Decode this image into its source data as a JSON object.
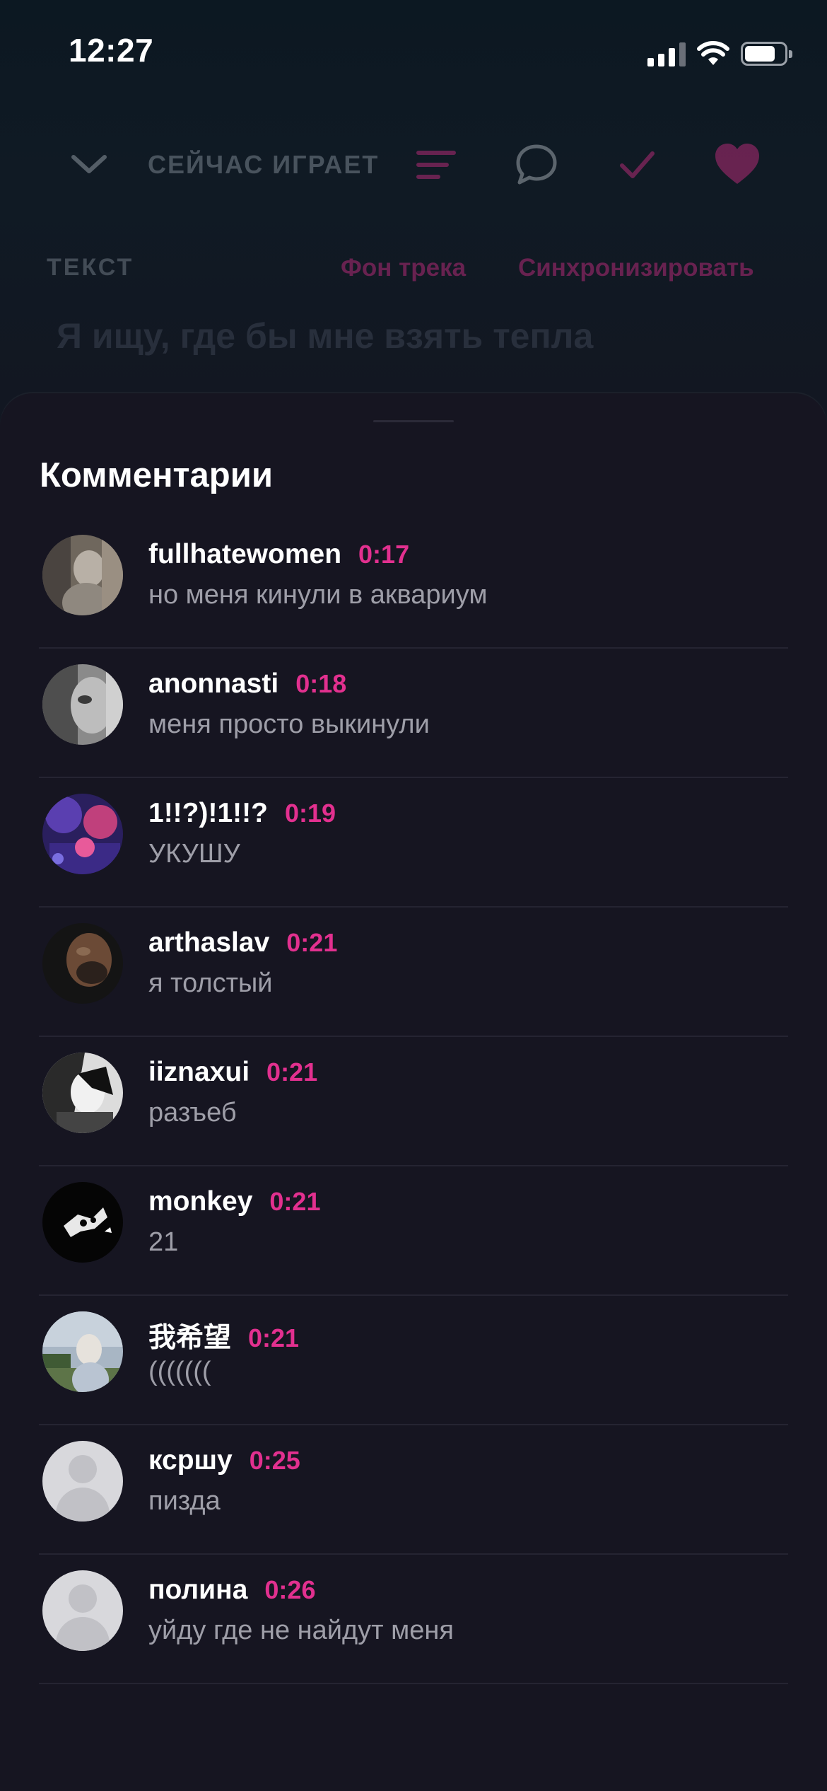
{
  "status_bar": {
    "time": "12:27"
  },
  "player": {
    "now_playing_label": "СЕЙЧАС ИГРАЕТ",
    "lyrics_label": "ТЕКСТ",
    "track_background_link": "Фон трека",
    "sync_link": "Синхронизировать",
    "lyrics_first_line": "Я ищу, где бы мне взять тепла",
    "accent_color": "#e2308f"
  },
  "comments": {
    "title": "Комментарии",
    "items": [
      {
        "user": "fullhatewomen",
        "time": "0:17",
        "text": "но меня кинули в аквариум",
        "avatar": "photo-avatar"
      },
      {
        "user": "anonnasti",
        "time": "0:18",
        "text": "меня просто выкинули",
        "avatar": "photo-avatar"
      },
      {
        "user": "1!!?)!1!!?",
        "time": "0:19",
        "text": "УКУШУ",
        "avatar": "photo-avatar"
      },
      {
        "user": "arthaslav",
        "time": "0:21",
        "text": "я толстый",
        "avatar": "photo-avatar"
      },
      {
        "user": "iiznaxui",
        "time": "0:21",
        "text": "разъеб",
        "avatar": "photo-avatar"
      },
      {
        "user": "monkey",
        "time": "0:21",
        "text": "21",
        "avatar": "photo-avatar"
      },
      {
        "user": "我希望",
        "time": "0:21",
        "text": "(((((((",
        "avatar": "photo-avatar"
      },
      {
        "user": "ксршу",
        "time": "0:25",
        "text": "пизда",
        "avatar": "default-avatar"
      },
      {
        "user": "полина",
        "time": "0:26",
        "text": "уйду где не найдут меня",
        "avatar": "default-avatar"
      }
    ]
  }
}
